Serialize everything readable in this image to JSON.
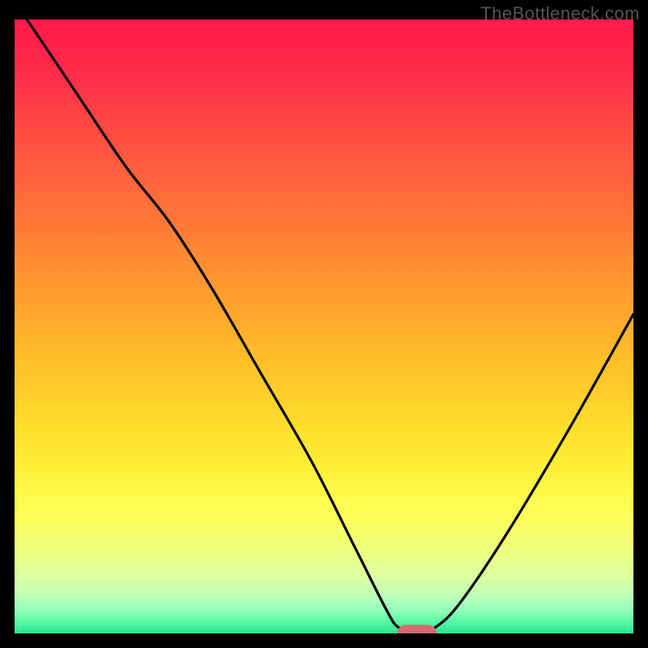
{
  "watermark": "TheBottleneck.com",
  "colors": {
    "bg": "#000000",
    "watermark": "#555555",
    "curve": "#000000",
    "marker_fill": "#d76a6f",
    "gradient_stops": [
      {
        "offset": 0.0,
        "color": "#ff1a4a"
      },
      {
        "offset": 0.08,
        "color": "#ff2a4a"
      },
      {
        "offset": 0.18,
        "color": "#ff4a42"
      },
      {
        "offset": 0.3,
        "color": "#ff6f3a"
      },
      {
        "offset": 0.42,
        "color": "#ff9530"
      },
      {
        "offset": 0.55,
        "color": "#ffbd28"
      },
      {
        "offset": 0.66,
        "color": "#ffdd2c"
      },
      {
        "offset": 0.74,
        "color": "#fff23a"
      },
      {
        "offset": 0.81,
        "color": "#fdff5a"
      },
      {
        "offset": 0.86,
        "color": "#f0ff7a"
      },
      {
        "offset": 0.905,
        "color": "#ddffa0"
      },
      {
        "offset": 0.94,
        "color": "#bcffb8"
      },
      {
        "offset": 0.965,
        "color": "#8affb4"
      },
      {
        "offset": 0.985,
        "color": "#4cf5a2"
      },
      {
        "offset": 1.0,
        "color": "#2de38f"
      }
    ]
  },
  "chart_data": {
    "type": "line",
    "title": "",
    "xlabel": "",
    "ylabel": "",
    "xlim": [
      0,
      100
    ],
    "ylim": [
      0,
      100
    ],
    "x": [
      2,
      10,
      18,
      25,
      32,
      40,
      48,
      55,
      60,
      62,
      65,
      68,
      72,
      80,
      90,
      100
    ],
    "values": [
      100,
      88,
      76,
      67,
      56,
      42,
      28,
      14,
      4,
      1,
      0,
      1,
      5,
      17,
      34,
      52
    ],
    "marker": {
      "x": 65,
      "y": 0,
      "rx": 3.2,
      "ry": 1.4
    }
  }
}
